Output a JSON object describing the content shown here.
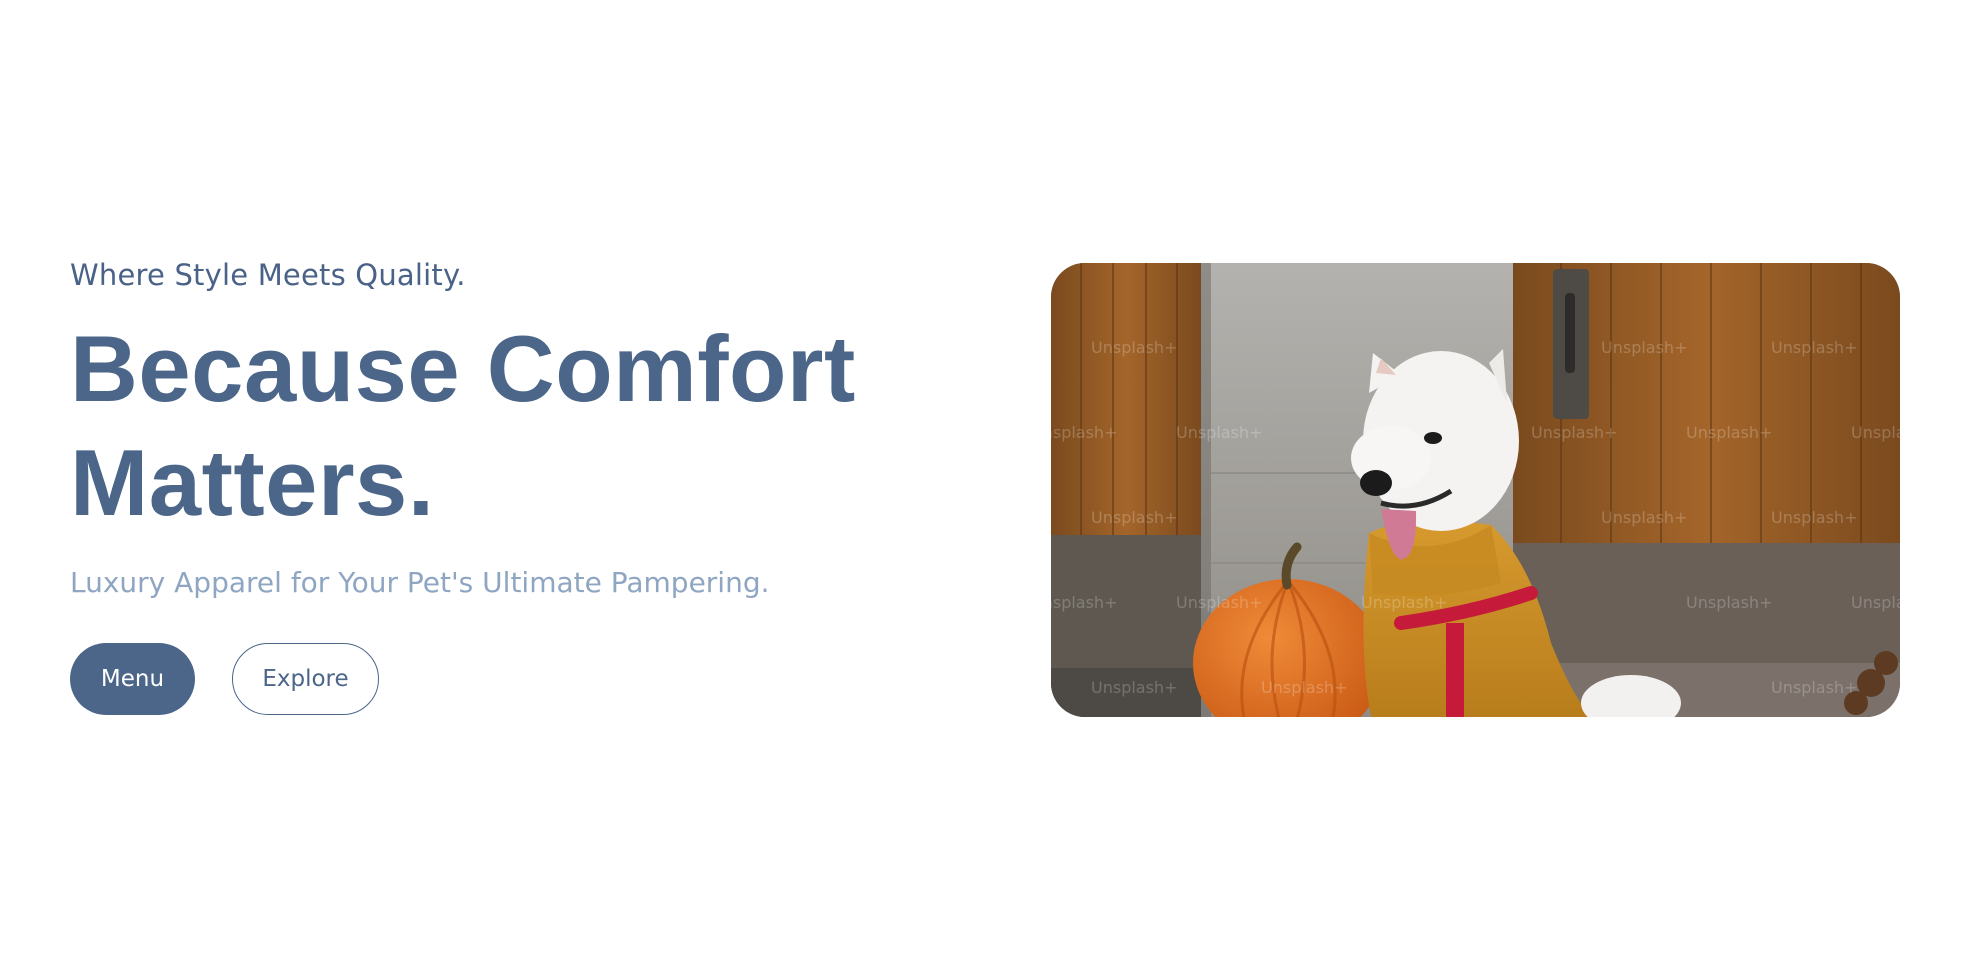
{
  "hero": {
    "eyebrow": "Where Style Meets Quality.",
    "headline": "Because Comfort Matters.",
    "subheadline": "Luxury Apparel for Your Pet's Ultimate Pampering.",
    "menu_button": "Menu",
    "explore_button": "Explore"
  },
  "image": {
    "watermark": "Unsplash+"
  },
  "colors": {
    "primary": "#4b6689",
    "subtext": "#8fa6c3",
    "background": "#ffffff"
  }
}
